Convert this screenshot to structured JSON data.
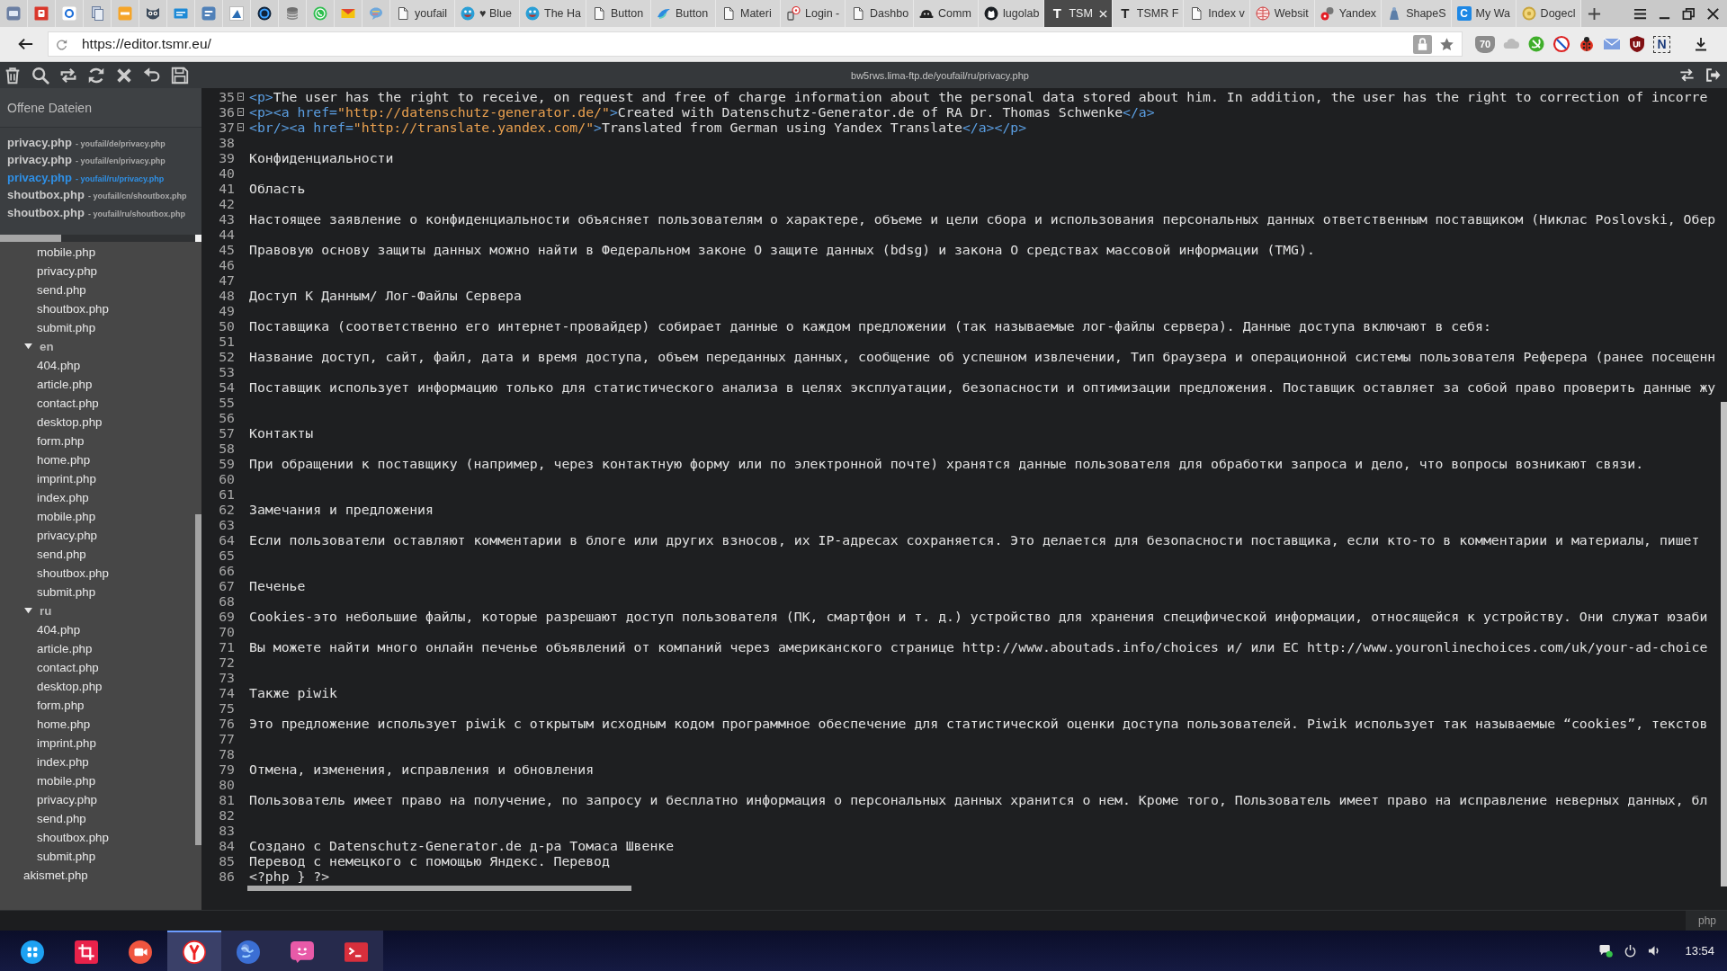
{
  "browser": {
    "tabs": [
      {
        "title": "youfail",
        "selected": false
      },
      {
        "title": "♥ Blue",
        "selected": false
      },
      {
        "title": "The Ha",
        "selected": false
      },
      {
        "title": "Button",
        "selected": false
      },
      {
        "title": "Button",
        "selected": false
      },
      {
        "title": "Materi",
        "selected": false
      },
      {
        "title": "Login -",
        "selected": false
      },
      {
        "title": "Dashbo",
        "selected": false
      },
      {
        "title": "Comm",
        "selected": false
      },
      {
        "title": "lugolab",
        "selected": false
      },
      {
        "title": "TSM",
        "selected": true,
        "icon_letter": "T"
      },
      {
        "title": "TSMR F",
        "selected": false,
        "icon_letter": "T"
      },
      {
        "title": "Index v",
        "selected": false
      },
      {
        "title": "Websit",
        "selected": false
      },
      {
        "title": "Yandex",
        "selected": false
      },
      {
        "title": "ShapeS",
        "selected": false
      },
      {
        "title": "My Wa",
        "selected": false,
        "icon_letter": "C"
      },
      {
        "title": "Dogecl",
        "selected": false
      }
    ],
    "address": "https://editor.tsmr.eu/",
    "extension_badge": "70",
    "extension_letter": "N"
  },
  "toolbar": {
    "path": "bw5rws.lima-ftp.de/youfail/ru/privacy.php"
  },
  "sidebar": {
    "title": "Offene Dateien",
    "open_files": [
      {
        "name": "privacy.php",
        "path": "- youfail/de/privacy.php",
        "selected": false
      },
      {
        "name": "privacy.php",
        "path": "- youfail/en/privacy.php",
        "selected": false
      },
      {
        "name": "privacy.php",
        "path": "- youfail/ru/privacy.php",
        "selected": true
      },
      {
        "name": "shoutbox.php",
        "path": "- youfail/cn/shoutbox.php",
        "selected": false
      },
      {
        "name": "shoutbox.php",
        "path": "- youfail/ru/shoutbox.php",
        "selected": false
      }
    ],
    "file_tree": [
      {
        "kind": "group",
        "children": [
          {
            "name": "mobile.php"
          },
          {
            "name": "privacy.php"
          },
          {
            "name": "send.php"
          },
          {
            "name": "shoutbox.php"
          },
          {
            "name": "submit.php"
          }
        ]
      },
      {
        "kind": "folder",
        "name": "en",
        "expanded": true,
        "children": [
          {
            "name": "404.php"
          },
          {
            "name": "article.php"
          },
          {
            "name": "contact.php"
          },
          {
            "name": "desktop.php"
          },
          {
            "name": "form.php"
          },
          {
            "name": "home.php"
          },
          {
            "name": "imprint.php"
          },
          {
            "name": "index.php"
          },
          {
            "name": "mobile.php"
          },
          {
            "name": "privacy.php"
          },
          {
            "name": "send.php"
          },
          {
            "name": "shoutbox.php"
          },
          {
            "name": "submit.php"
          }
        ]
      },
      {
        "kind": "folder",
        "name": "ru",
        "expanded": true,
        "children": [
          {
            "name": "404.php"
          },
          {
            "name": "article.php"
          },
          {
            "name": "contact.php"
          },
          {
            "name": "desktop.php"
          },
          {
            "name": "form.php"
          },
          {
            "name": "home.php"
          },
          {
            "name": "imprint.php"
          },
          {
            "name": "index.php"
          },
          {
            "name": "mobile.php"
          },
          {
            "name": "privacy.php"
          },
          {
            "name": "send.php"
          },
          {
            "name": "shoutbox.php"
          },
          {
            "name": "submit.php"
          }
        ]
      },
      {
        "kind": "file",
        "name": "akismet.php"
      }
    ]
  },
  "editor": {
    "lines": [
      {
        "number": "35",
        "fold": true,
        "parts": [
          {
            "kind": "tag",
            "text": "<p>"
          },
          {
            "kind": "text",
            "text": "The user has the right to receive, on request and free of charge information about the personal data stored about him. In addition, the user has the right to correction of incorre"
          }
        ]
      },
      {
        "number": "36",
        "fold": true,
        "parts": [
          {
            "kind": "tag",
            "text": "<p><a href="
          },
          {
            "kind": "string",
            "text": "\"http://datenschutz-generator.de/\""
          },
          {
            "kind": "tag",
            "text": ">"
          },
          {
            "kind": "text",
            "text": "Created with Datenschutz-Generator.de of RA Dr. Thomas Schwenke"
          },
          {
            "kind": "tag",
            "text": "</a>"
          }
        ]
      },
      {
        "number": "37",
        "fold": true,
        "parts": [
          {
            "kind": "tag",
            "text": "<br/><a href="
          },
          {
            "kind": "string",
            "text": "\"http://translate.yandex.com/\""
          },
          {
            "kind": "tag",
            "text": ">"
          },
          {
            "kind": "text",
            "text": "Translated from German using Yandex Translate"
          },
          {
            "kind": "tag",
            "text": "</a></p>"
          }
        ]
      },
      {
        "number": "38",
        "fold": false
      },
      {
        "number": "39",
        "fold": false,
        "parts": [
          {
            "kind": "text",
            "text": "Конфиденциальности"
          }
        ]
      },
      {
        "number": "40",
        "fold": false
      },
      {
        "number": "41",
        "fold": false,
        "parts": [
          {
            "kind": "text",
            "text": "Область"
          }
        ]
      },
      {
        "number": "42",
        "fold": false
      },
      {
        "number": "43",
        "fold": false,
        "parts": [
          {
            "kind": "text",
            "text": "Настоящее заявление о конфиденциальности объясняет пользователям о характере, объеме и цели сбора и использования персональных данных ответственным поставщиком (Никлас Poslovski, Обер"
          }
        ]
      },
      {
        "number": "44",
        "fold": false
      },
      {
        "number": "45",
        "fold": false,
        "parts": [
          {
            "kind": "text",
            "text": "Правовую основу защиты данных можно найти в Федеральном законе О защите данных (bdsg) и закона О средствах массовой информации (TMG)."
          }
        ]
      },
      {
        "number": "46",
        "fold": false
      },
      {
        "number": "47",
        "fold": false
      },
      {
        "number": "48",
        "fold": false,
        "parts": [
          {
            "kind": "text",
            "text": "Доступ К Данным/ Лог-Файлы Сервера"
          }
        ]
      },
      {
        "number": "49",
        "fold": false
      },
      {
        "number": "50",
        "fold": false,
        "parts": [
          {
            "kind": "text",
            "text": "Поставщика (соответственно его интернет-провайдер) собирает данные о каждом предложении (так называемые лог-файлы сервера). Данные доступа включают в себя:"
          }
        ]
      },
      {
        "number": "51",
        "fold": false
      },
      {
        "number": "52",
        "fold": false,
        "parts": [
          {
            "kind": "text",
            "text": "Название доступ, сайт, файл, дата и время доступа, объем переданных данных, сообщение об успешном извлечении, Тип браузера и операционной системы пользователя Реферера (ранее посещенн"
          }
        ]
      },
      {
        "number": "53",
        "fold": false
      },
      {
        "number": "54",
        "fold": false,
        "parts": [
          {
            "kind": "text",
            "text": "Поставщик использует информацию только для статистического анализа в целях эксплуатации, безопасности и оптимизации предложения. Поставщик оставляет за собой право проверить данные жу"
          }
        ]
      },
      {
        "number": "55",
        "fold": false
      },
      {
        "number": "56",
        "fold": false
      },
      {
        "number": "57",
        "fold": false,
        "parts": [
          {
            "kind": "text",
            "text": "Контакты"
          }
        ]
      },
      {
        "number": "58",
        "fold": false
      },
      {
        "number": "59",
        "fold": false,
        "parts": [
          {
            "kind": "text",
            "text": "При обращении к поставщику (например, через контактную форму или по электронной почте) хранятся данные пользователя для обработки запроса и дело, что вопросы возникают связи."
          }
        ]
      },
      {
        "number": "60",
        "fold": false
      },
      {
        "number": "61",
        "fold": false
      },
      {
        "number": "62",
        "fold": false,
        "parts": [
          {
            "kind": "text",
            "text": "Замечания и предложения"
          }
        ]
      },
      {
        "number": "63",
        "fold": false
      },
      {
        "number": "64",
        "fold": false,
        "parts": [
          {
            "kind": "text",
            "text": "Если пользователи оставляют комментарии в блоге или других взносов, их IP-адресах сохраняется. Это делается для безопасности поставщика, если кто-то в комментарии и материалы, пишет"
          }
        ]
      },
      {
        "number": "65",
        "fold": false
      },
      {
        "number": "66",
        "fold": false
      },
      {
        "number": "67",
        "fold": false,
        "parts": [
          {
            "kind": "text",
            "text": "Печенье"
          }
        ]
      },
      {
        "number": "68",
        "fold": false
      },
      {
        "number": "69",
        "fold": false,
        "parts": [
          {
            "kind": "text",
            "text": "Cookies-это небольшие файлы, которые разрешают доступ пользователя (ПК, смартфон и т. д.) устройство для хранения специфической информации, относящейся к устройству. Они служат юзаби"
          }
        ]
      },
      {
        "number": "70",
        "fold": false
      },
      {
        "number": "71",
        "fold": false,
        "parts": [
          {
            "kind": "text",
            "text": "Вы можете найти много онлайн печенье объявлений от компаний через американского странице http://www.aboutads.info/choices и/ или ЕС http://www.youronlinechoices.com/uk/your-ad-choice"
          }
        ]
      },
      {
        "number": "72",
        "fold": false
      },
      {
        "number": "73",
        "fold": false
      },
      {
        "number": "74",
        "fold": false,
        "parts": [
          {
            "kind": "text",
            "text": "Также piwik"
          }
        ]
      },
      {
        "number": "75",
        "fold": false
      },
      {
        "number": "76",
        "fold": false,
        "parts": [
          {
            "kind": "text",
            "text": "Это предложение использует piwik с открытым исходным кодом программное обеспечение для статистической оценки доступа пользователей. Piwik использует так называемые “cookies”, текстов"
          }
        ]
      },
      {
        "number": "77",
        "fold": false
      },
      {
        "number": "78",
        "fold": false
      },
      {
        "number": "79",
        "fold": false,
        "parts": [
          {
            "kind": "text",
            "text": "Отмена, изменения, исправления и обновления"
          }
        ]
      },
      {
        "number": "80",
        "fold": false
      },
      {
        "number": "81",
        "fold": false,
        "parts": [
          {
            "kind": "text",
            "text": "Пользователь имеет право на получение, по запросу и бесплатно информация о персональных данных хранится о нем. Кроме того, Пользователь имеет право на исправление неверных данных, бл"
          }
        ]
      },
      {
        "number": "82",
        "fold": false
      },
      {
        "number": "83",
        "fold": false
      },
      {
        "number": "84",
        "fold": false,
        "parts": [
          {
            "kind": "text",
            "text": "Создано с Datenschutz-Generator.de д-ра Томаса Швенке"
          }
        ]
      },
      {
        "number": "85",
        "fold": false,
        "parts": [
          {
            "kind": "text",
            "text": "Перевод с немецкого с помощью Яндекс. Перевод"
          }
        ]
      },
      {
        "number": "86",
        "fold": false,
        "parts": [
          {
            "kind": "text",
            "text": "<?php } ?>"
          }
        ]
      }
    ]
  },
  "status_bar": {
    "language": "php"
  },
  "taskbar": {
    "apps": [
      {
        "running": false,
        "selected": false
      },
      {
        "running": false,
        "selected": false
      },
      {
        "running": false,
        "selected": false
      },
      {
        "running": true,
        "selected": true
      },
      {
        "running": true,
        "selected": false
      },
      {
        "running": true,
        "selected": false
      },
      {
        "running": true,
        "selected": false
      }
    ],
    "clock": "13:54"
  }
}
